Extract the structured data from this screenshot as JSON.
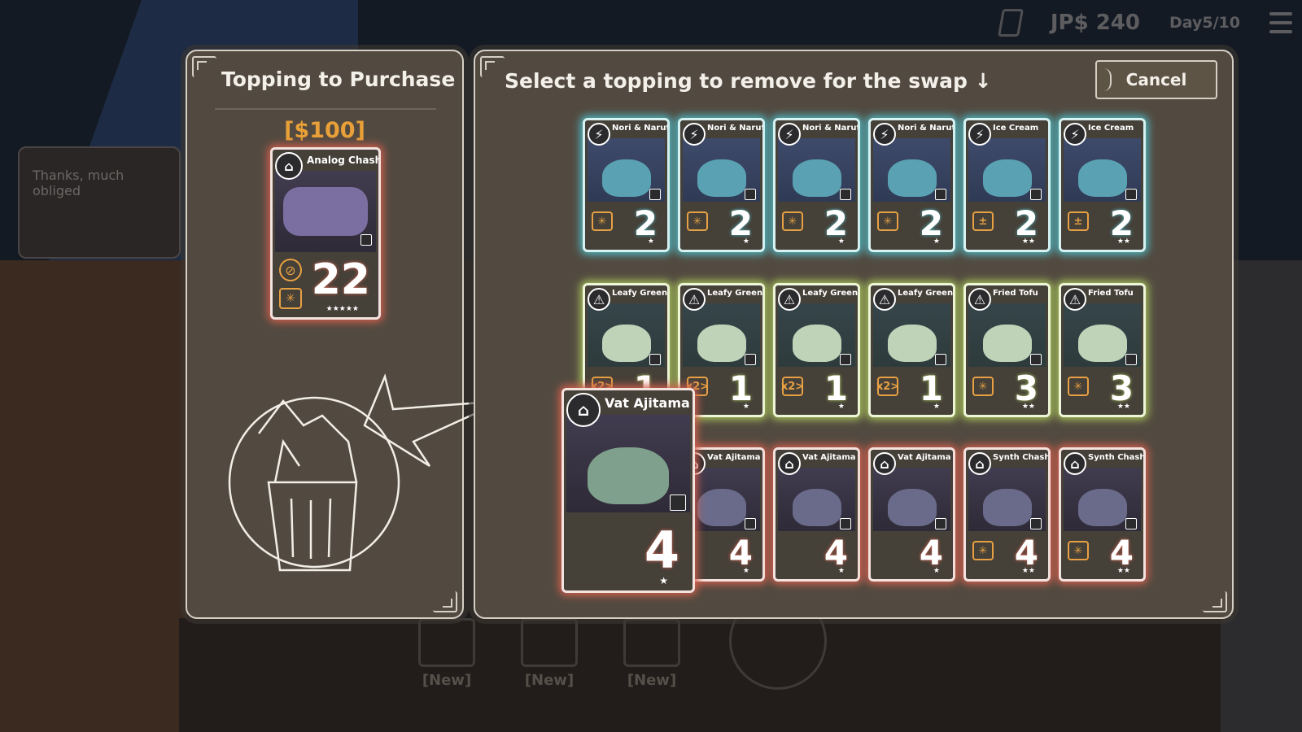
{
  "hud": {
    "money": "JP$ 240",
    "day": "Day5/10"
  },
  "dialog": {
    "text": "Thanks, much obliged"
  },
  "new_slots": [
    "[New]",
    "[New]",
    "[New]"
  ],
  "purchase_panel": {
    "title": "Topping to Purchase",
    "price": "[$100]",
    "card": {
      "name": "Analog Chashu",
      "symbol": "⌂",
      "score": "22",
      "stars": "★★★★★",
      "tag_a": "⊘",
      "tag_b": "✳"
    }
  },
  "swap_panel": {
    "title": "Select a topping to remove for the swap ↓",
    "cancel_label": "Cancel",
    "row1": [
      {
        "name": "Nori & Naruto",
        "symbol": "⚡",
        "tag": "✳",
        "score": "2",
        "stars": "★"
      },
      {
        "name": "Nori & Naruto",
        "symbol": "⚡",
        "tag": "✳",
        "score": "2",
        "stars": "★"
      },
      {
        "name": "Nori & Naruto",
        "symbol": "⚡",
        "tag": "✳",
        "score": "2",
        "stars": "★"
      },
      {
        "name": "Nori & Naruto",
        "symbol": "⚡",
        "tag": "✳",
        "score": "2",
        "stars": "★"
      },
      {
        "name": "Ice Cream",
        "symbol": "⚡",
        "tag": "±",
        "score": "2",
        "stars": "★★"
      },
      {
        "name": "Ice Cream",
        "symbol": "⚡",
        "tag": "±",
        "score": "2",
        "stars": "★★"
      }
    ],
    "row2": [
      {
        "name": "Leafy Greens",
        "symbol": "⚠",
        "tag": "x2>",
        "score": "1",
        "stars": "★"
      },
      {
        "name": "Leafy Greens",
        "symbol": "⚠",
        "tag": "x2>",
        "score": "1",
        "stars": "★"
      },
      {
        "name": "Leafy Greens",
        "symbol": "⚠",
        "tag": "x2>",
        "score": "1",
        "stars": "★"
      },
      {
        "name": "Leafy Greens",
        "symbol": "⚠",
        "tag": "x2>",
        "score": "1",
        "stars": "★"
      },
      {
        "name": "Fried Tofu",
        "symbol": "⚠",
        "tag": "✳",
        "score": "3",
        "stars": "★★"
      },
      {
        "name": "Fried Tofu",
        "symbol": "⚠",
        "tag": "✳",
        "score": "3",
        "stars": "★★"
      }
    ],
    "row3": [
      {
        "name": "Vat Ajitama",
        "symbol": "⌂",
        "tag": "",
        "score": "4",
        "stars": "★"
      },
      {
        "name": "Vat Ajitama",
        "symbol": "⌂",
        "tag": "",
        "score": "4",
        "stars": "★"
      },
      {
        "name": "Vat Ajitama",
        "symbol": "⌂",
        "tag": "",
        "score": "4",
        "stars": "★"
      },
      {
        "name": "Vat Ajitama",
        "symbol": "⌂",
        "tag": "",
        "score": "4",
        "stars": "★"
      },
      {
        "name": "Synth Chashu",
        "symbol": "⌂",
        "tag": "✳",
        "score": "4",
        "stars": "★★"
      },
      {
        "name": "Synth Chashu",
        "symbol": "⌂",
        "tag": "✳",
        "score": "4",
        "stars": "★★"
      }
    ],
    "hovered_card": {
      "name": "Vat Ajitama",
      "symbol": "⌂",
      "score": "4",
      "stars": "★"
    }
  },
  "colors": {
    "blue_glow": "#4fb7c2",
    "green_glow": "#a7c25a",
    "red_glow": "#d2604e",
    "price": "#e9a038"
  },
  "icons": [
    "menu-icon",
    "trash-bin-icon",
    "magnify-icon",
    "lightning-icon",
    "warning-icon",
    "bowl-icon"
  ]
}
